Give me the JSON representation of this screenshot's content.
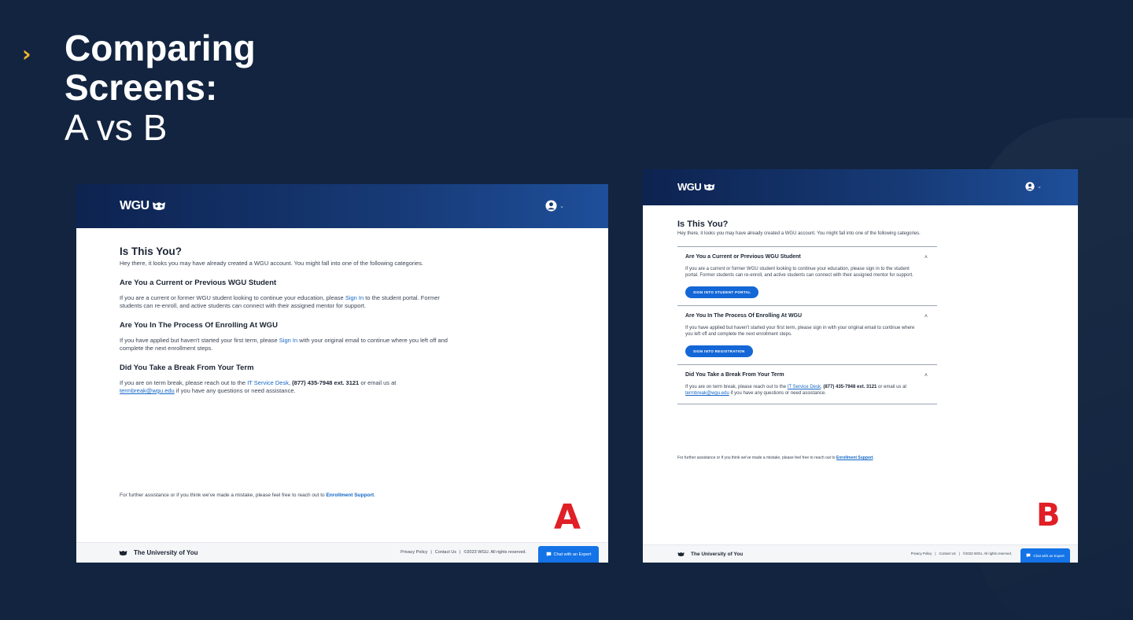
{
  "slide": {
    "title_line1": "Comparing",
    "title_line2": "Screens:",
    "subtitle": "A vs B"
  },
  "colors": {
    "background": "#12243f",
    "accent_chevron": "#f2b42d",
    "label_red": "#e01f26",
    "link_blue": "#1467c6",
    "button_blue": "#1467d6"
  },
  "screen_a": {
    "label": "A",
    "logo": "WGU",
    "title": "Is This You?",
    "intro": "Hey there, it looks you may have already created a WGU account. You might fall into one of the following categories.",
    "sections": [
      {
        "heading": "Are You a Current or Previous WGU Student",
        "text_before": "If you are a current or former WGU student looking to continue your education, please ",
        "link": "Sign In",
        "text_after": " to the student portal. Former students can re-enroll, and active students can connect with their assigned mentor for support."
      },
      {
        "heading": "Are You In The Process Of Enrolling At WGU",
        "text_before": "If you have applied but haven't started your first term, please ",
        "link": "Sign In",
        "text_after": " with your original email to continue where you left off and complete the next enrollment steps."
      },
      {
        "heading": "Did You Take a Break From Your Term",
        "text_before": "If you are on term break, please reach out to the ",
        "link": "IT Service Desk",
        "phone": "(877) 435-7948 ext. 3121",
        "text_mid": " or email us at ",
        "email": "termbreak@wgu.edu",
        "text_after": " if you have any questions or need assistance."
      }
    ],
    "footer_note": "For further assistance or if you think we've made a mistake, please feel free to reach out to ",
    "footer_note_link": "Enrollment Support",
    "tagline": "The University of You",
    "privacy": "Privacy Policy",
    "contact": "Contact Us",
    "copyright": "©2023 WGU. All rights reserved.",
    "chat": "Chat with an Expert"
  },
  "screen_b": {
    "label": "B",
    "logo": "WGU",
    "title": "Is This You?",
    "intro": "Hey there, it looks you may have already created a WGU account. You might fall into one of the following categories.",
    "sections": [
      {
        "heading": "Are You a Current or Previous WGU Student",
        "text": "If you are a current or former WGU student looking to continue your education, please sign in to the student portal. Former students can re-enroll, and active students can connect with their assigned mentor for support.",
        "button": "SIGN INTO STUDENT PORTAL"
      },
      {
        "heading": "Are You In The Process Of Enrolling At WGU",
        "text": "If you have applied but haven't started your first term, please sign in with your original email to continue where you left off and complete the next enrollment steps.",
        "button": "SIGN INTO REGISTRATION"
      },
      {
        "heading": "Did You Take a Break From Your Term",
        "text_before": "If you are on term break, please reach out to the ",
        "link": "IT Service Desk",
        "phone": "(877) 435-7948 ext. 3121",
        "text_mid": " or email us at ",
        "email": "termbreak@wgu.edu",
        "text_after": " if you have any questions or need assistance."
      }
    ],
    "footer_note": "For further assistance or if you think we've made a mistake, please feel free to reach out to ",
    "footer_note_link": "Enrollment Support",
    "tagline": "The University of You",
    "privacy": "Privacy Policy",
    "contact": "Contact Us",
    "copyright": "©2023 WGU. All rights reserved.",
    "chat": "Chat with an Expert"
  }
}
